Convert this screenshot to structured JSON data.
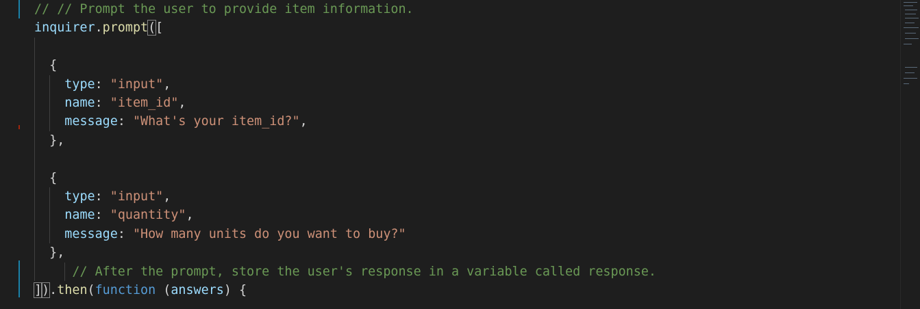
{
  "editor": {
    "lines": [
      {
        "tokens": [
          {
            "t": "// // Prompt the user to provide item information.",
            "c": "comment"
          }
        ]
      },
      {
        "tokens": [
          {
            "t": "inquirer",
            "c": "ident"
          },
          {
            "t": ".",
            "c": "punc"
          },
          {
            "t": "prompt",
            "c": "func"
          },
          {
            "t": "(",
            "c": "punc",
            "match": true
          },
          {
            "t": "[",
            "c": "punc"
          }
        ]
      },
      {
        "tokens": []
      },
      {
        "tokens": [
          {
            "t": "  {",
            "c": "punc"
          }
        ]
      },
      {
        "tokens": [
          {
            "t": "    ",
            "c": "punc"
          },
          {
            "t": "type",
            "c": "ident"
          },
          {
            "t": ": ",
            "c": "punc"
          },
          {
            "t": "\"input\"",
            "c": "str"
          },
          {
            "t": ",",
            "c": "punc"
          }
        ]
      },
      {
        "tokens": [
          {
            "t": "    ",
            "c": "punc"
          },
          {
            "t": "name",
            "c": "ident"
          },
          {
            "t": ": ",
            "c": "punc"
          },
          {
            "t": "\"item_id\"",
            "c": "str"
          },
          {
            "t": ",",
            "c": "punc"
          }
        ]
      },
      {
        "tokens": [
          {
            "t": "    ",
            "c": "punc"
          },
          {
            "t": "message",
            "c": "ident"
          },
          {
            "t": ": ",
            "c": "punc"
          },
          {
            "t": "\"What's your item_id?\"",
            "c": "str"
          },
          {
            "t": ",",
            "c": "punc"
          }
        ]
      },
      {
        "tokens": [
          {
            "t": "  },",
            "c": "punc"
          }
        ]
      },
      {
        "tokens": []
      },
      {
        "tokens": [
          {
            "t": "  {",
            "c": "punc"
          }
        ]
      },
      {
        "tokens": [
          {
            "t": "    ",
            "c": "punc"
          },
          {
            "t": "type",
            "c": "ident"
          },
          {
            "t": ": ",
            "c": "punc"
          },
          {
            "t": "\"input\"",
            "c": "str"
          },
          {
            "t": ",",
            "c": "punc"
          }
        ]
      },
      {
        "tokens": [
          {
            "t": "    ",
            "c": "punc"
          },
          {
            "t": "name",
            "c": "ident"
          },
          {
            "t": ": ",
            "c": "punc"
          },
          {
            "t": "\"quantity\"",
            "c": "str"
          },
          {
            "t": ",",
            "c": "punc"
          }
        ]
      },
      {
        "tokens": [
          {
            "t": "    ",
            "c": "punc"
          },
          {
            "t": "message",
            "c": "ident"
          },
          {
            "t": ": ",
            "c": "punc"
          },
          {
            "t": "\"How many units do you want to buy?\"",
            "c": "str"
          }
        ]
      },
      {
        "tokens": [
          {
            "t": "  },",
            "c": "punc"
          }
        ]
      },
      {
        "tokens": [
          {
            "t": "     ",
            "c": "punc"
          },
          {
            "t": "// After the prompt, store the user's response in a variable called response.",
            "c": "comment"
          }
        ]
      },
      {
        "tokens": [
          {
            "t": "]",
            "c": "punc",
            "match": true
          },
          {
            "t": ")",
            "c": "punc",
            "match": true
          },
          {
            "t": ".",
            "c": "punc"
          },
          {
            "t": "then",
            "c": "func"
          },
          {
            "t": "(",
            "c": "punc"
          },
          {
            "t": "function",
            "c": "kw"
          },
          {
            "t": " (",
            "c": "punc"
          },
          {
            "t": "answers",
            "c": "ident"
          },
          {
            "t": ") {",
            "c": "punc"
          }
        ]
      }
    ]
  },
  "theme": {
    "background": "#1e1e1e",
    "comment": "#6a9955",
    "identifier": "#9cdcfe",
    "function": "#dcdcaa",
    "string": "#ce9178",
    "keyword": "#569cd6",
    "gutter_modified": "#1b81a8",
    "gutter_deleted": "#a1260d"
  }
}
